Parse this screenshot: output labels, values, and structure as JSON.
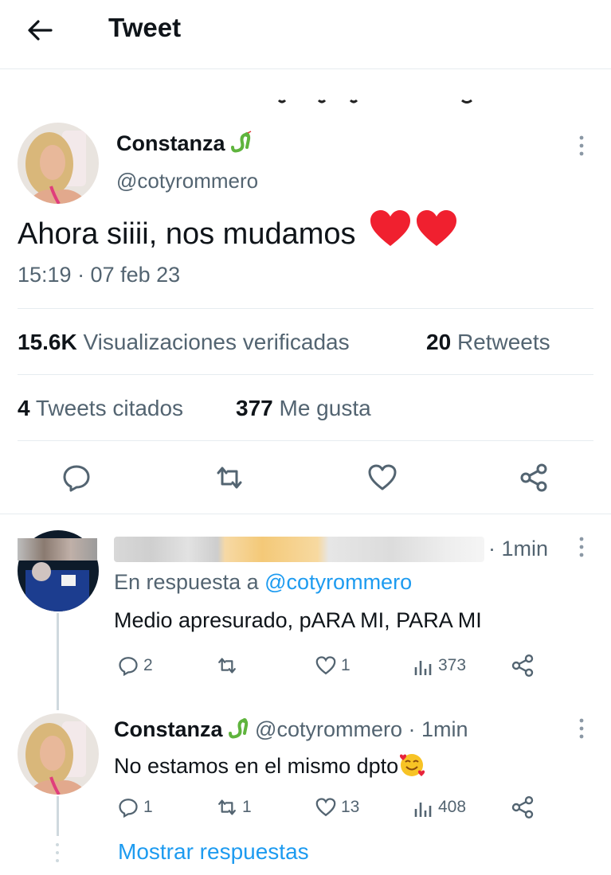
{
  "header": {
    "title": "Tweet",
    "back_icon": "arrow-left-icon"
  },
  "tweet": {
    "author_name": "Constanza",
    "author_handle": "@cotyrommero",
    "text": "Ahora siiii, nos mudamos",
    "text_emoji": "red-heart-emoji x2",
    "time": "15:19 · 07 feb 23"
  },
  "stats": {
    "views_count": "15.6K",
    "views_label": "Visualizaciones verificadas",
    "retweets_count": "20",
    "retweets_label": "Retweets",
    "quotes_count": "4",
    "quotes_label": "Tweets citados",
    "likes_count": "377",
    "likes_label": "Me gusta"
  },
  "actions": [
    "reply-icon",
    "retweet-icon",
    "like-icon",
    "share-icon"
  ],
  "replies": [
    {
      "time": "· 1min",
      "reply_to_prefix": "En respuesta a",
      "reply_to_handle": "@cotyrommero",
      "text": "Medio apresurado, pARA MI, PARA MI",
      "reply_count": "2",
      "retweet_count": "",
      "like_count": "1",
      "view_count": "373"
    },
    {
      "author_name": "Constanza",
      "author_handle": "@cotyrommero",
      "time": "· 1min",
      "text": "No estamos en el mismo dpto",
      "reply_count": "1",
      "retweet_count": "1",
      "like_count": "13",
      "view_count": "408"
    }
  ],
  "show_replies_label": "Mostrar respuestas",
  "colors": {
    "accent": "#1d9bf0",
    "secondary_text": "#536471",
    "divider": "#e6ecf0"
  }
}
